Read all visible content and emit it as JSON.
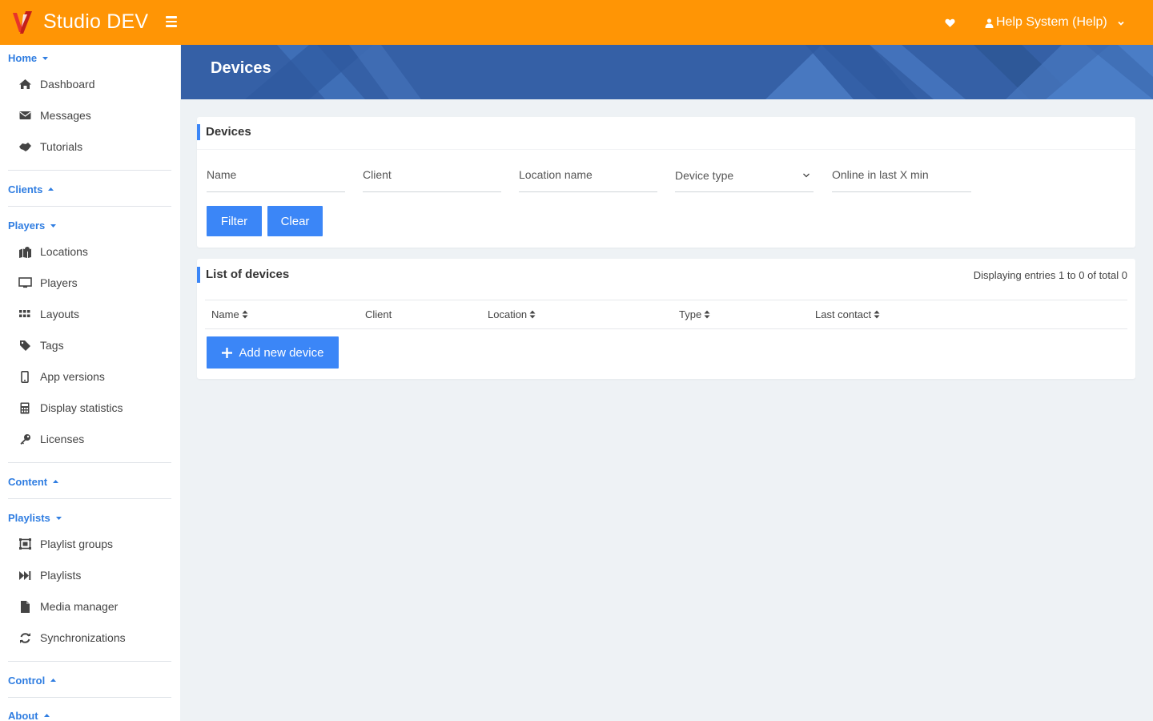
{
  "header": {
    "app_title": "Studio DEV",
    "user_label": "Help System (Help)",
    "accent_color": "#ff9505"
  },
  "sidebar": {
    "sections": {
      "home": "Home",
      "clients": "Clients",
      "players": "Players",
      "content": "Content",
      "playlists": "Playlists",
      "control": "Control",
      "about": "About"
    },
    "items": {
      "dashboard": "Dashboard",
      "messages": "Messages",
      "tutorials": "Tutorials",
      "locations": "Locations",
      "players": "Players",
      "layouts": "Layouts",
      "tags": "Tags",
      "app_versions": "App versions",
      "display_statistics": "Display statistics",
      "licenses": "Licenses",
      "playlist_groups": "Playlist groups",
      "playlists": "Playlists",
      "media_manager": "Media manager",
      "synchronizations": "Synchronizations"
    }
  },
  "page": {
    "title": "Devices"
  },
  "filter": {
    "title": "Devices",
    "name_placeholder": "Name",
    "client_placeholder": "Client",
    "location_placeholder": "Location name",
    "device_type_label": "Device type",
    "online_placeholder": "Online in last X min",
    "filter_button": "Filter",
    "clear_button": "Clear"
  },
  "devices_list": {
    "title": "List of devices",
    "entries_info": "Displaying entries 1 to 0 of total 0",
    "columns": {
      "name": "Name",
      "client": "Client",
      "location": "Location",
      "type": "Type",
      "last_contact": "Last contact"
    },
    "add_button": "Add new device"
  },
  "colors": {
    "primary": "#3b86f7",
    "banner": "#3560a6",
    "link": "#2f7de1"
  }
}
